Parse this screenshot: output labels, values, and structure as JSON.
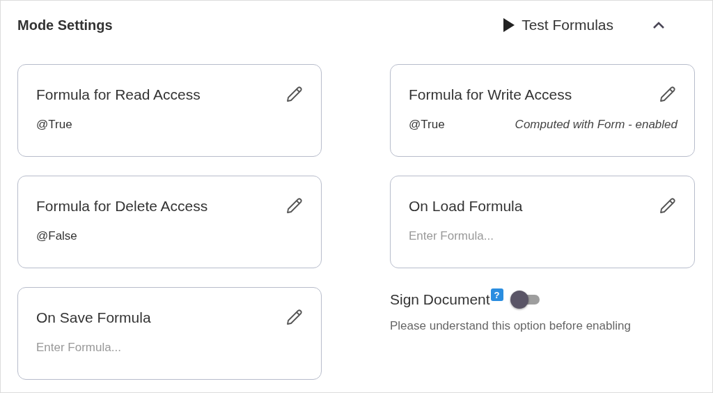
{
  "header": {
    "title": "Mode Settings",
    "test_button": "Test Formulas",
    "collapse_expanded": true
  },
  "items": [
    {
      "kind": "formula",
      "title": "Formula for Read Access",
      "value": "@True"
    },
    {
      "kind": "formula",
      "title": "Formula for Write Access",
      "value": "@True",
      "note": "Computed with Form - enabled"
    },
    {
      "kind": "formula",
      "title": "Formula for Delete Access",
      "value": "@False"
    },
    {
      "kind": "formula",
      "title": "On Load Formula",
      "placeholder": "Enter Formula..."
    },
    {
      "kind": "formula",
      "title": "On Save Formula",
      "placeholder": "Enter Formula..."
    },
    {
      "kind": "toggle",
      "label": "Sign Document",
      "help": "?",
      "on": false,
      "hint": "Please understand this option before enabling"
    }
  ]
}
